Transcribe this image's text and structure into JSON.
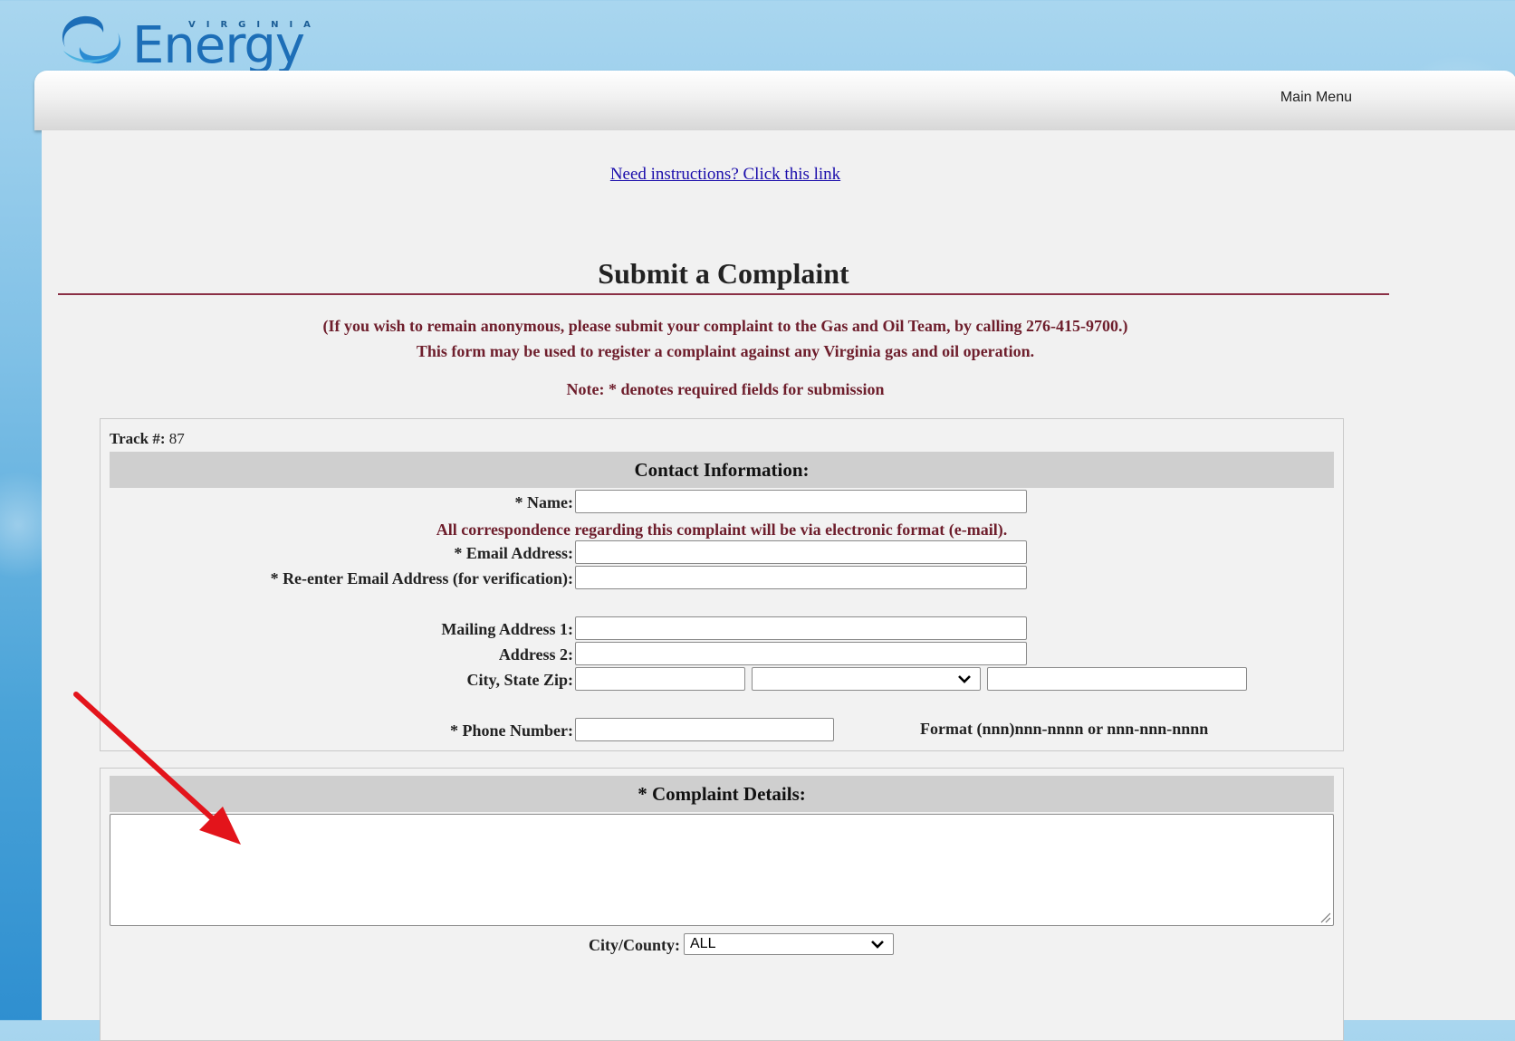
{
  "brand": {
    "logo_small": "VIRGINIA",
    "logo_big": "Energy"
  },
  "nav": {
    "main_menu": "Main Menu"
  },
  "page": {
    "instructions_link": "Need instructions? Click this link",
    "title": "Submit a Complaint",
    "intro_line1": "(If you wish to remain anonymous, please submit your complaint to the Gas and Oil Team, by calling 276-415-9700.)",
    "intro_line2": "This form may be used to register a complaint against any Virginia gas and oil operation.",
    "note": "Note: * denotes required fields for submission"
  },
  "contact": {
    "track_label": "Track #:",
    "track_value": "87",
    "header": "Contact Information:",
    "name_label": "* Name:",
    "correspondence_note": "All correspondence regarding this complaint will be via electronic format (e-mail).",
    "email_label": "* Email Address:",
    "email_confirm_label": "* Re-enter Email Address (for verification):",
    "mailing1_label": "Mailing Address 1:",
    "address2_label": "Address 2:",
    "city_state_zip_label": "City, State Zip:",
    "state_selected": "",
    "phone_label": "* Phone Number:",
    "phone_format": "Format (nnn)nnn-nnnn or nnn-nnn-nnnn"
  },
  "complaint": {
    "header": "* Complaint Details:",
    "city_county_label": "City/County:",
    "city_county_selected": "ALL"
  },
  "colors": {
    "accent_red": "#e3141b",
    "rule": "#8a2f45",
    "note_text": "#6e1e2c"
  }
}
